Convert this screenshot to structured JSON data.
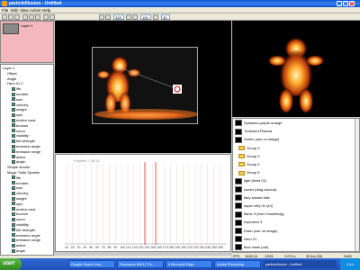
{
  "window": {
    "title": "particleIllusion - Untitled"
  },
  "menu": [
    "File",
    "Edit",
    "View",
    "Action",
    "Help"
  ],
  "toolbar": {
    "frame_value": "333",
    "zoom_value": "100",
    "fps_value": "30"
  },
  "layer_panel": {
    "label": "Layer 1"
  },
  "tree": [
    {
      "label": "Layer 1",
      "indent": 0,
      "color": ""
    },
    {
      "label": "Offset",
      "indent": 1,
      "color": ""
    },
    {
      "label": "Angle",
      "indent": 1,
      "color": ""
    },
    {
      "label": "Hero 01 2",
      "indent": 1,
      "color": ""
    },
    {
      "label": "life",
      "indent": 2,
      "color": "#1aa28f"
    },
    {
      "label": "number",
      "indent": 2,
      "color": "#1aa28f"
    },
    {
      "label": "size",
      "indent": 2,
      "color": "#1aa28f"
    },
    {
      "label": "velocity",
      "indent": 2,
      "color": "#1aa28f"
    },
    {
      "label": "weight",
      "indent": 2,
      "color": "#1aa28f"
    },
    {
      "label": "spin",
      "indent": 2,
      "color": "#1aa28f"
    },
    {
      "label": "motion rand.",
      "indent": 2,
      "color": "#1aa28f"
    },
    {
      "label": "bounce",
      "indent": 2,
      "color": "#1aa28f"
    },
    {
      "label": "zoom",
      "indent": 2,
      "color": "#1aa28f"
    },
    {
      "label": "visibility",
      "indent": 2,
      "color": "#1aa28f"
    },
    {
      "label": "tint strength",
      "indent": 2,
      "color": "#1aa28f"
    },
    {
      "label": "emission angle",
      "indent": 2,
      "color": "#1aa28f"
    },
    {
      "label": "emission range",
      "indent": 2,
      "color": "#1aa28f"
    },
    {
      "label": "active",
      "indent": 2,
      "color": "#1aa28f"
    },
    {
      "label": "angle",
      "indent": 2,
      "color": "#1aa28f"
    },
    {
      "label": "Simple smoke",
      "indent": 1,
      "color": ""
    },
    {
      "label": "Magic Trails Sparkle",
      "indent": 1,
      "color": ""
    },
    {
      "label": "life",
      "indent": 2,
      "color": "#1aa28f"
    },
    {
      "label": "number",
      "indent": 2,
      "color": "#1aa28f"
    },
    {
      "label": "size",
      "indent": 2,
      "color": "#1aa28f"
    },
    {
      "label": "velocity",
      "indent": 2,
      "color": "#1aa28f"
    },
    {
      "label": "weight",
      "indent": 2,
      "color": "#1aa28f"
    },
    {
      "label": "spin",
      "indent": 2,
      "color": "#1aa28f"
    },
    {
      "label": "motion rand.",
      "indent": 2,
      "color": "#1aa28f"
    },
    {
      "label": "bounce",
      "indent": 2,
      "color": "#1aa28f"
    },
    {
      "label": "zoom",
      "indent": 2,
      "color": "#1aa28f"
    },
    {
      "label": "visibility",
      "indent": 2,
      "color": "#1aa28f"
    },
    {
      "label": "tint strength",
      "indent": 2,
      "color": "#1aa28f"
    },
    {
      "label": "emission angle",
      "indent": 2,
      "color": "#1aa28f"
    },
    {
      "label": "emission range",
      "indent": 2,
      "color": "#1aa28f"
    },
    {
      "label": "active",
      "indent": 2,
      "color": "#1aa28f"
    },
    {
      "label": "angle",
      "indent": 2,
      "color": "#1aa28f"
    }
  ],
  "library": [
    {
      "type": "emitter",
      "label": "Splashes purple-orange"
    },
    {
      "type": "emitter",
      "label": "Turbulent Plasma"
    },
    {
      "type": "emitter",
      "label": "Vortex (use on image)"
    },
    {
      "type": "folder",
      "label": "Group 2"
    },
    {
      "type": "folder",
      "label": "Group 3"
    },
    {
      "type": "folder",
      "label": "Group 4"
    },
    {
      "type": "folder",
      "label": "Group 5"
    },
    {
      "type": "emitter",
      "label": "light (fixed 01)"
    },
    {
      "type": "emitter",
      "label": "comet (drag around)"
    },
    {
      "type": "emitter",
      "label": "fiery smoke falls"
    },
    {
      "type": "emitter",
      "label": "super nifty 01 (lnl)"
    },
    {
      "type": "emitter",
      "label": "flame 3 (from Gouldberg)"
    },
    {
      "type": "emitter",
      "label": "explosion 3"
    },
    {
      "type": "emitter",
      "label": "Drain (use on image)"
    },
    {
      "type": "emitter",
      "label": "Hero 01"
    },
    {
      "type": "emitter",
      "label": "blue mists (old)"
    }
  ],
  "timeline": {
    "position_label": "Position = 00.21",
    "ruler": [
      "10",
      "20",
      "30",
      "40",
      "50",
      "60",
      "70",
      "80",
      "90",
      "100",
      "110",
      "120",
      "130",
      "140",
      "150",
      "160",
      "170",
      "180",
      "190",
      "200",
      "210",
      "220",
      "230",
      "240",
      "250",
      "260"
    ]
  },
  "status": {
    "fps": "FPS",
    "mem": "1048.16",
    "frame": "1/333",
    "counter": "3.074 s",
    "fpsval": "30 fps (30)",
    "mode": "NUM"
  },
  "taskbar": {
    "start": "start",
    "tasks": [
      "Google Search Ima...",
      "Panorama IMG17-Pe...",
      "4 Microsoft Edge",
      "Adobe Photoshop",
      "particleIllusion - Untitled"
    ],
    "clock": "3:44"
  },
  "colors": {
    "accent": "#0a58d8",
    "layer_panel": "#f3b7bd",
    "tree_swatch": "#1aa28f"
  }
}
